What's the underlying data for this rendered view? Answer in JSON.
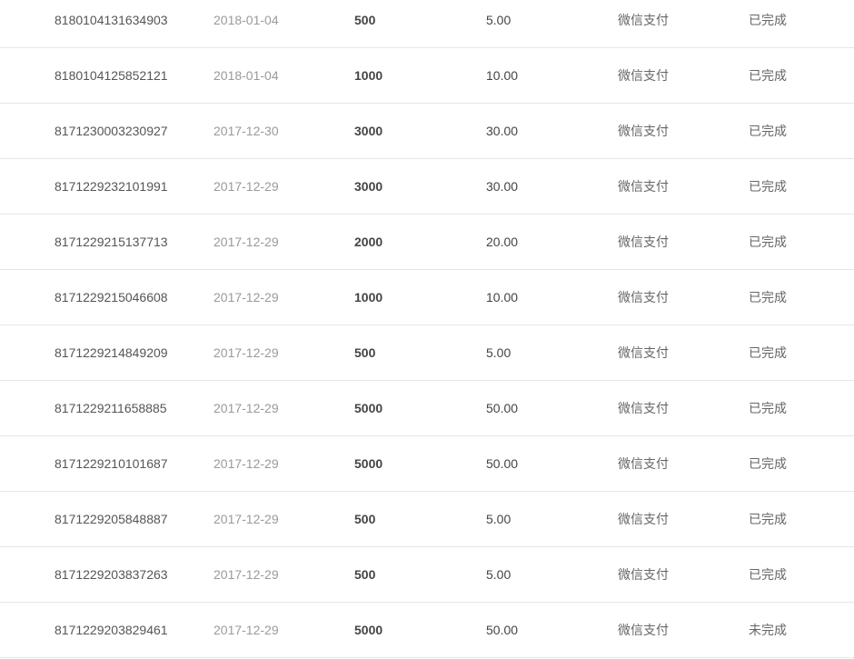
{
  "orders": [
    {
      "order_no": "8180104131634903",
      "date": "2018-01-04",
      "points": "500",
      "amount": "5.00",
      "method": "微信支付",
      "status": "已完成"
    },
    {
      "order_no": "8180104125852121",
      "date": "2018-01-04",
      "points": "1000",
      "amount": "10.00",
      "method": "微信支付",
      "status": "已完成"
    },
    {
      "order_no": "8171230003230927",
      "date": "2017-12-30",
      "points": "3000",
      "amount": "30.00",
      "method": "微信支付",
      "status": "已完成"
    },
    {
      "order_no": "8171229232101991",
      "date": "2017-12-29",
      "points": "3000",
      "amount": "30.00",
      "method": "微信支付",
      "status": "已完成"
    },
    {
      "order_no": "8171229215137713",
      "date": "2017-12-29",
      "points": "2000",
      "amount": "20.00",
      "method": "微信支付",
      "status": "已完成"
    },
    {
      "order_no": "8171229215046608",
      "date": "2017-12-29",
      "points": "1000",
      "amount": "10.00",
      "method": "微信支付",
      "status": "已完成"
    },
    {
      "order_no": "8171229214849209",
      "date": "2017-12-29",
      "points": "500",
      "amount": "5.00",
      "method": "微信支付",
      "status": "已完成"
    },
    {
      "order_no": "8171229211658885",
      "date": "2017-12-29",
      "points": "5000",
      "amount": "50.00",
      "method": "微信支付",
      "status": "已完成"
    },
    {
      "order_no": "8171229210101687",
      "date": "2017-12-29",
      "points": "5000",
      "amount": "50.00",
      "method": "微信支付",
      "status": "已完成"
    },
    {
      "order_no": "8171229205848887",
      "date": "2017-12-29",
      "points": "500",
      "amount": "5.00",
      "method": "微信支付",
      "status": "已完成"
    },
    {
      "order_no": "8171229203837263",
      "date": "2017-12-29",
      "points": "500",
      "amount": "5.00",
      "method": "微信支付",
      "status": "已完成"
    },
    {
      "order_no": "8171229203829461",
      "date": "2017-12-29",
      "points": "5000",
      "amount": "50.00",
      "method": "微信支付",
      "status": "未完成"
    }
  ]
}
